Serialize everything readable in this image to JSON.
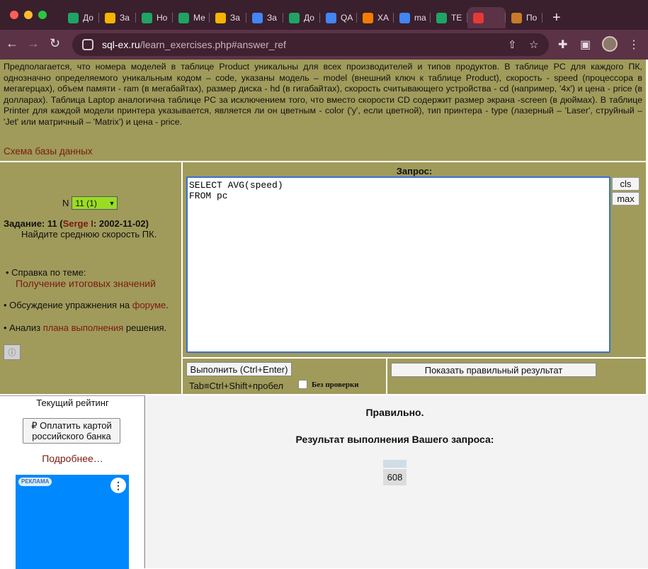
{
  "browser": {
    "tabs": [
      {
        "label": "До",
        "icon": "green-feather-icon",
        "color": "#1fa463"
      },
      {
        "label": "За",
        "icon": "slides-icon",
        "color": "#f4b400"
      },
      {
        "label": "Но",
        "icon": "green-feather-icon",
        "color": "#1fa463"
      },
      {
        "label": "Ме",
        "icon": "green-feather-icon",
        "color": "#1fa463"
      },
      {
        "label": "За",
        "icon": "slides-icon",
        "color": "#f4b400"
      },
      {
        "label": "За",
        "icon": "drive-icon",
        "color": "#4285f4"
      },
      {
        "label": "До",
        "icon": "green-feather-icon",
        "color": "#1fa463"
      },
      {
        "label": "QA",
        "icon": "drive-icon",
        "color": "#4285f4"
      },
      {
        "label": "XA",
        "icon": "diamond-icon",
        "color": "#f57c00"
      },
      {
        "label": "ma",
        "icon": "google-icon",
        "color": "#4285f4"
      },
      {
        "label": "TE",
        "icon": "green-feather-icon",
        "color": "#1fa463"
      },
      {
        "label": "",
        "icon": "target-icon",
        "color": "#e53935"
      },
      {
        "label": "По",
        "icon": "s-icon",
        "color": "#c77b2a"
      }
    ],
    "url_host": "sql-ex.ru",
    "url_path": "/learn_exercises.php#answer_ref"
  },
  "description": "Предполагается, что номера моделей в таблице Product уникальны для всех производителей и типов продуктов. В таблице PC для каждого ПК, однозначно определяемого уникальным кодом – code, указаны модель – model (внешний ключ к таблице Product), скорость - speed (процессора в мегагерцах), объем памяти - ram (в мегабайтах), размер диска - hd (в гигабайтах), скорость считывающего устройства - cd (например, '4x') и цена - price (в долларах). Таблица Laptop аналогична таблице PC за исключением того, что вместо скорости CD содержит размер экрана -screen (в дюймах). В таблице Printer для каждой модели принтера указывается, является ли он цветным - color ('y', если цветной), тип принтера - type (лазерный – 'Laser', струйный – 'Jet' или матричный – 'Matrix') и цена - price.",
  "schema_link": "Схема базы данных",
  "task": {
    "n_label": "N",
    "selected": "11 (1)",
    "title_prefix": "Задание: 11 (",
    "author": "Serge I",
    "title_suffix": ": 2002-11-02)",
    "text": "Найдите среднюю скорость ПК."
  },
  "help": {
    "label": "• Справка по теме:",
    "link": "Получение итоговых значений",
    "discuss_prefix": "• Обсуждение упражнения на",
    "discuss_link": "форуме",
    "discuss_suffix": ".",
    "analyze_prefix": "• Анализ",
    "analyze_link": "плана выполнения",
    "analyze_suffix": "решения."
  },
  "query": {
    "label": "Запрос:",
    "text": "SELECT AVG(speed)\nFROM pc",
    "cls_label": "cls",
    "max_label": "max",
    "run_label": "Выполнить (Ctrl+Enter)",
    "tab_hint": "Tab≡Ctrl+Shift+пробел",
    "no_check_label": "Без проверки",
    "show_label": "Показать правильный результат"
  },
  "rating": {
    "title": "Текущий рейтинг",
    "pay_label": "₽ Оплатить картой российского банка",
    "more_link": "Подробнее…",
    "ad_badge": "РЕКЛАМА"
  },
  "result": {
    "status": "Правильно.",
    "title": "Результат выполнения Вашего запроса:",
    "value": "608"
  }
}
